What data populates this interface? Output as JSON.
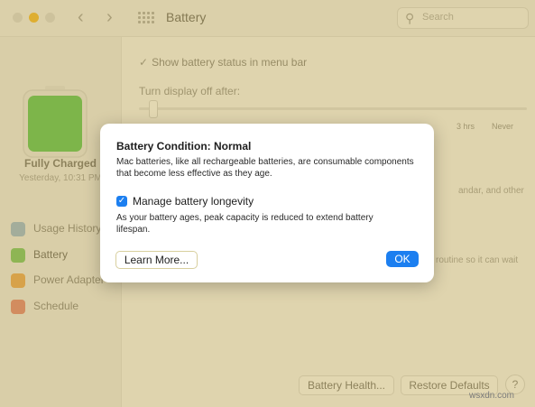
{
  "window": {
    "title": "Battery",
    "search_placeholder": "Search"
  },
  "sidebar": {
    "status_title": "Fully Charged",
    "status_time": "Yesterday, 10:31 PM",
    "items": [
      {
        "label": "Usage History",
        "icon": "usage-history-icon"
      },
      {
        "label": "Battery",
        "icon": "battery-icon"
      },
      {
        "label": "Power Adapter",
        "icon": "power-adapter-icon"
      },
      {
        "label": "Schedule",
        "icon": "schedule-icon"
      }
    ]
  },
  "main": {
    "show_status_label": "Show battery status in menu bar",
    "turn_off_label": "Turn display off after:",
    "tick_3hrs": "3 hrs",
    "tick_never": "Never",
    "fragment_1": "andar, and other",
    "fragment_2": "routine so it can wait",
    "battery_health_button": "Battery Health...",
    "restore_defaults_button": "Restore Defaults",
    "help_button": "?"
  },
  "dialog": {
    "title": "Battery Condition: Normal",
    "body": "Mac batteries, like all rechargeable batteries, are consumable components that become less effective as they age.",
    "checkbox_label": "Manage battery longevity",
    "checkbox_checked": true,
    "note": "As your battery ages, peak capacity is reduced to extend battery lifespan.",
    "learn_more_button": "Learn More...",
    "ok_button": "OK"
  },
  "watermark": "wsxdn.com",
  "colors": {
    "accent": "#1c7ff0",
    "overlay_tint": "#bea54b",
    "battery_fill": "#4fc24a"
  }
}
